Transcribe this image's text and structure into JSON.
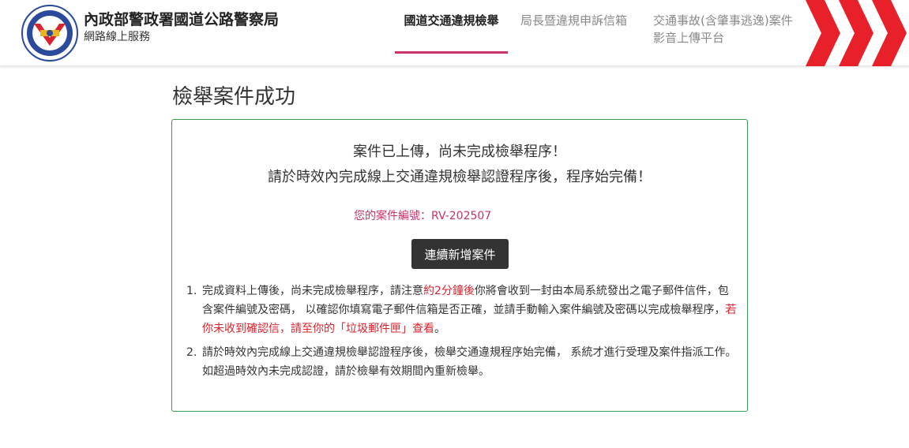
{
  "header": {
    "org_name": "內政部警政署國道公路警察局",
    "org_sub": "網路線上服務",
    "nav": [
      {
        "label": "國道交通違規檢舉",
        "active": true
      },
      {
        "label": "局長暨違規申訴信箱",
        "active": false
      },
      {
        "label_line1": "交通事故(含肇事逃逸)案件",
        "label_line2": "影音上傳平台",
        "active": false
      }
    ],
    "accent_color": "#c8336a",
    "chevron_color": "#e8202a"
  },
  "page": {
    "title": "檢舉案件成功"
  },
  "card": {
    "message_line1": "案件已上傳，尚未完成檢舉程序！",
    "message_line2": "請於時效內完成線上交通違規檢舉認證程序後，程序始完備！",
    "case_number": "您的案件編號：RV-202507",
    "button_label": "連續新增案件",
    "border_color": "#3c9a4b"
  },
  "notes": [
    {
      "number": "1.",
      "part1": "完成資料上傳後，尚未完成檢舉程序，請注意",
      "highlight1": "約2分鐘後",
      "part2": "你將會收到一封由本局系統發出之電子郵件信件，包含案件編號及密碼， 以確認你填寫電子郵件信箱是否正確，並請手動輸入案件編號及密碼以完成檢舉程序，",
      "highlight2": "若你未收到確認信，請至你的「垃圾郵件匣」查看",
      "part3": "。"
    },
    {
      "number": "2.",
      "text": "請於時效內完成線上交通違規檢舉認證程序後，檢舉交通違規程序始完備， 系統才進行受理及案件指派工作。如超過時效內未完成認證，請於檢舉有效期間內重新檢舉。"
    }
  ]
}
